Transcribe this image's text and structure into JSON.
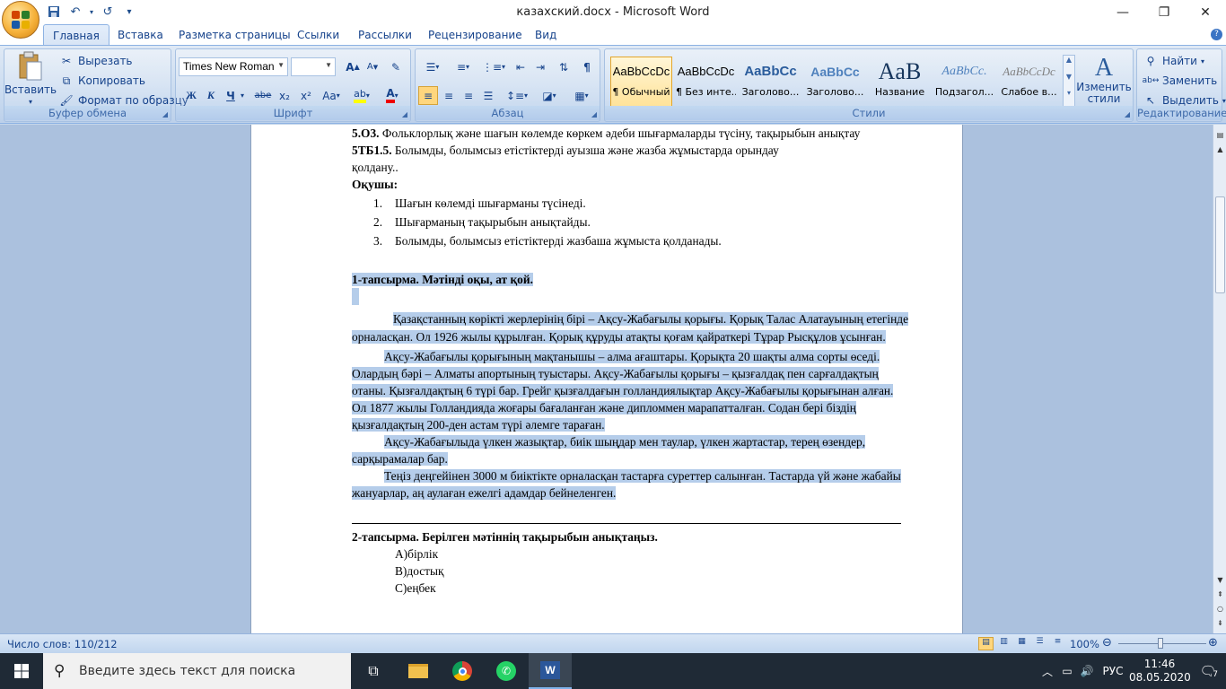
{
  "window": {
    "title": "казахский.docx - Microsoft Word"
  },
  "qat": {
    "save_icon": "save-icon",
    "undo_icon": "undo-icon",
    "redo_icon": "redo-icon",
    "customize_icon": "customize-icon"
  },
  "tabs": [
    "Главная",
    "Вставка",
    "Разметка страницы",
    "Ссылки",
    "Рассылки",
    "Рецензирование",
    "Вид"
  ],
  "clipboard": {
    "paste": "Вставить",
    "cut": "Вырезать",
    "copy": "Копировать",
    "format_painter": "Формат по образцу",
    "label": "Буфер обмена"
  },
  "font": {
    "name": "Times New Roman",
    "size": "",
    "label": "Шрифт",
    "bold": "Ж",
    "italic": "К",
    "underline": "Ч",
    "strike": "abe",
    "subscript": "x₂",
    "superscript": "x²",
    "case": "Aa",
    "grow": "A",
    "shrink": "A"
  },
  "paragraph": {
    "label": "Абзац"
  },
  "styles": {
    "label": "Стили",
    "items": [
      {
        "sample": "AaBbCcDc",
        "name": "¶ Обычный"
      },
      {
        "sample": "AaBbCcDc",
        "name": "¶ Без инте..."
      },
      {
        "sample": "AaBbCс",
        "name": "Заголово..."
      },
      {
        "sample": "AaBbCc",
        "name": "Заголово..."
      },
      {
        "sample": "AaB",
        "name": "Название"
      },
      {
        "sample": "AaBbCc.",
        "name": "Подзагол..."
      },
      {
        "sample": "AaBbCcDc",
        "name": "Слабое в..."
      }
    ],
    "change": "Изменить стили"
  },
  "editing": {
    "find": "Найти",
    "replace": "Заменить",
    "select": "Выделить",
    "label": "Редактирование"
  },
  "document": {
    "line1_bold": "5.О3.",
    "line1": " Фольклорлық және шағын көлемде көркем әдеби шығармаларды түсіну, тақырыбын анықтау",
    "line2_bold": "5ТБ1.5.",
    "line2": " Болымды, болымсыз етістіктерді ауызша және жазба жұмыстарда орындау",
    "line2b": "қолдану..",
    "pupil": "Оқушы:",
    "list": [
      {
        "n": "1.",
        "t": "Шағын көлемді шығарманы түсінеді."
      },
      {
        "n": "2.",
        "t": "Шығарманың тақырыбын анықтайды."
      },
      {
        "n": "3.",
        "t": "Болымды, болымсыз етістіктерді жазбаша жұмыста қолданады."
      }
    ],
    "task1": "1-тапсырма. Мәтінді оқы, ат қой.",
    "p1": "Қазақстанның көрікті жерлерінің бірі – Ақсу-Жабағылы қорығы. Қорық Талас Алатауының етегінде орналасқан. Ол 1926 жылы құрылған. Қорық құруды атақты қоғам қайраткері Тұрар Рысқұлов ұсынған.",
    "p2": "Ақсу-Жабағылы қорығының мақтанышы – алма ағаштары. Қорықта 20 шақты алма сорты өседі. Олардың бәрі – Алматы апортының туыстары. Ақсу-Жабағылы қорығы – қызғалдақ пен сарғалдақтың отаны. Қызғалдақтың 6 түрі бар. Грейг қызғалдағын голландиялықтар Ақсу-Жабағылы қорығынан алған. Ол 1877 жылы Голландияда жоғары бағаланған және дипломмен марапатталған. Содан бері біздің қызғалдақтың 200-ден астам түрі әлемге тараған.",
    "p3": "Ақсу-Жабағылыда үлкен жазықтар, биік шыңдар мен таулар, үлкен жартастар, терең өзендер, сарқырамалар бар.",
    "p4": "Теңіз деңгейінен 3000 м биіктікте орналасқан тастарға суреттер салынған. Тастарда үй және жабайы жануарлар, аң аулаған ежелгі адамдар бейнеленген.",
    "task2": "2-тапсырма. Берілген мәтіннің тақырыбын анықтаңыз.",
    "options": [
      "А)бірлік",
      "В)достық",
      "С)еңбек"
    ]
  },
  "status": {
    "words": "Число слов: 110/212",
    "zoom": "100%"
  },
  "taskbar": {
    "search_placeholder": "Введите здесь текст для поиска",
    "lang": "РУС",
    "time": "11:46",
    "date": "08.05.2020",
    "notif_count": "7"
  }
}
